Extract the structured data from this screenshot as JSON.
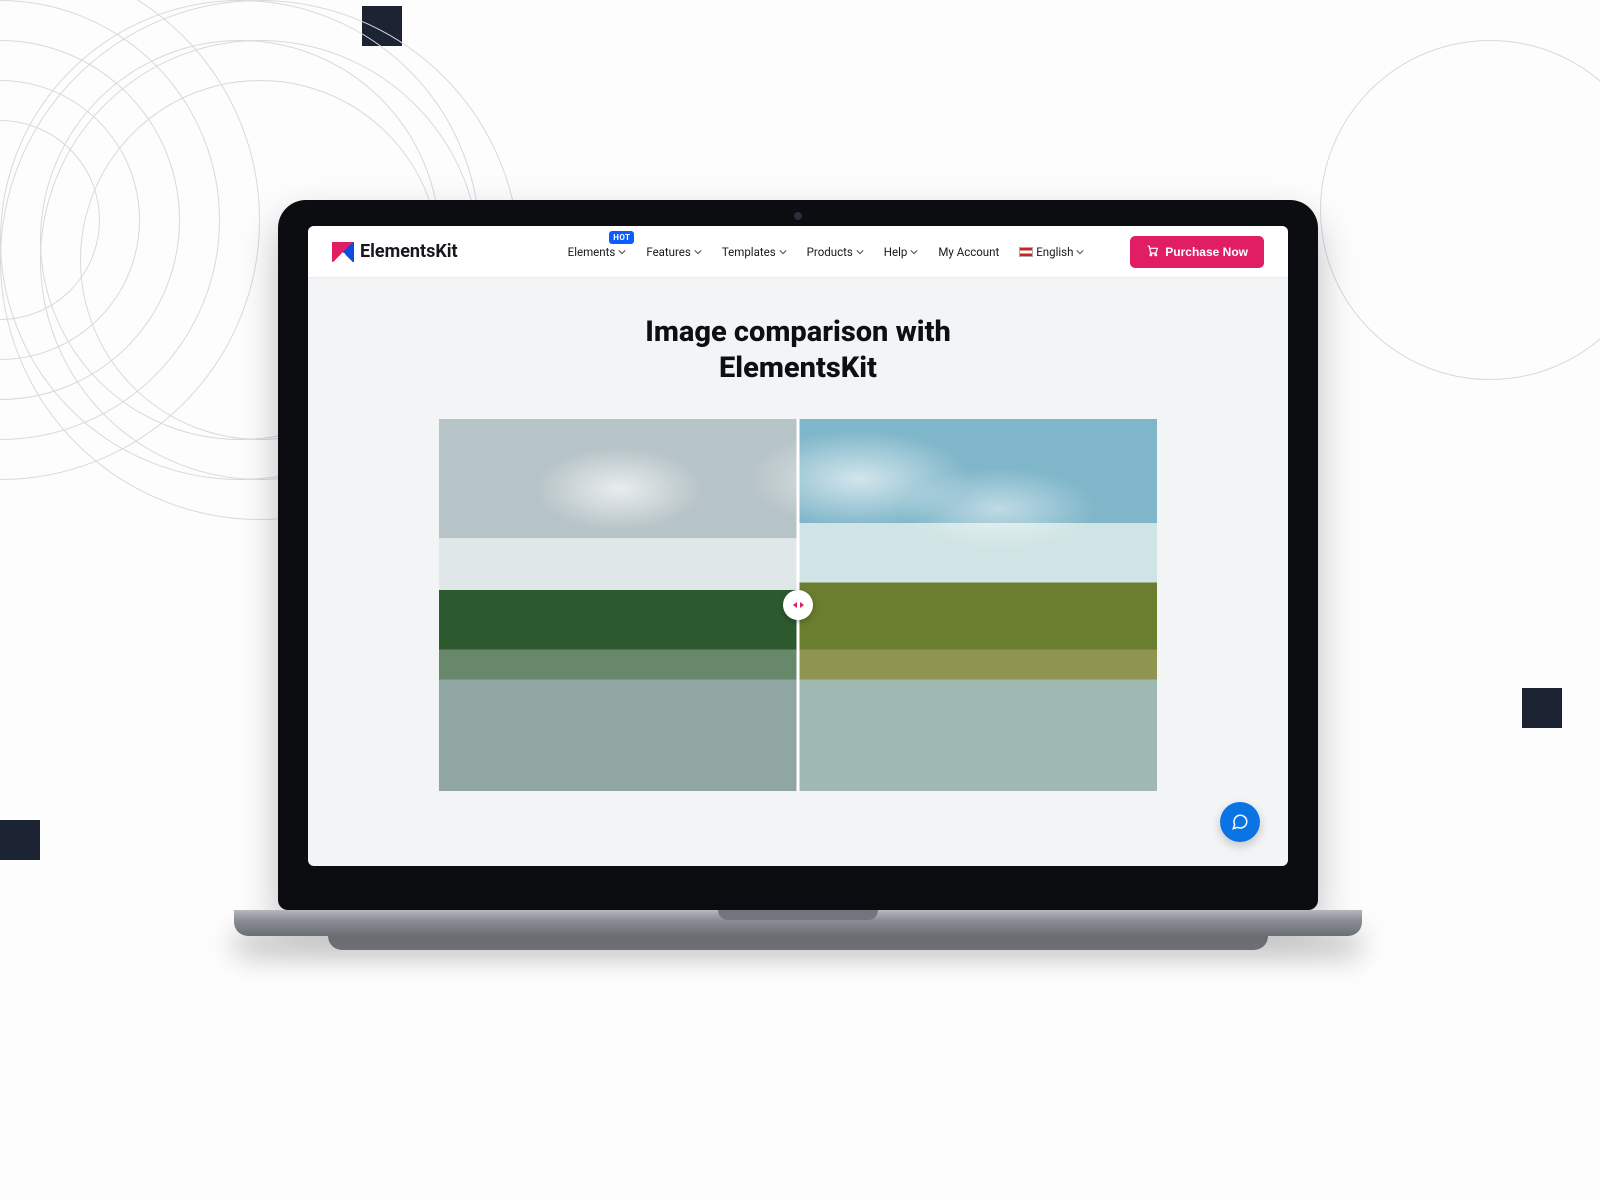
{
  "brand": {
    "name": "ElementsKit"
  },
  "nav": {
    "items": [
      {
        "label": "Elements",
        "dropdown": true,
        "badge": "HOT"
      },
      {
        "label": "Features",
        "dropdown": true
      },
      {
        "label": "Templates",
        "dropdown": true
      },
      {
        "label": "Products",
        "dropdown": true
      },
      {
        "label": "Help",
        "dropdown": true
      },
      {
        "label": "My Account",
        "dropdown": false
      },
      {
        "label": "English",
        "dropdown": true,
        "flag": "us"
      }
    ]
  },
  "cta": {
    "purchase": "Purchase Now"
  },
  "page": {
    "title_line1": "Image comparison with",
    "title_line2": "ElementsKit"
  },
  "comparison": {
    "slider_position_percent": 50,
    "before_alt": "cool-tone lake landscape",
    "after_alt": "warm-tone lake landscape"
  },
  "icons": {
    "chat": "chat-bubble"
  }
}
